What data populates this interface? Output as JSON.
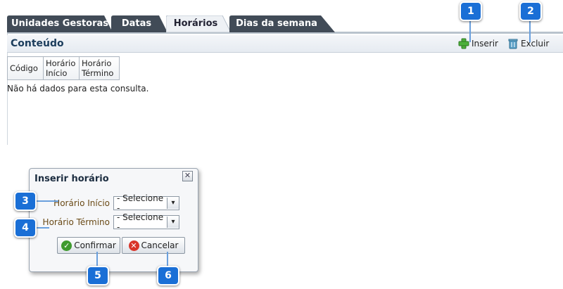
{
  "tabs": [
    {
      "label": "Unidades Gestoras",
      "active": false
    },
    {
      "label": "Datas",
      "active": false
    },
    {
      "label": "Horários",
      "active": true
    },
    {
      "label": "Dias da semana",
      "active": false
    }
  ],
  "panel": {
    "title": "Conteúdo",
    "insert_label": "Inserir",
    "delete_label": "Excluir",
    "columns": [
      "Código",
      "Horário Início",
      "Horário Término"
    ],
    "empty_message": "Não há dados para esta consulta."
  },
  "dialog": {
    "title": "Inserir horário",
    "start_label": "Horário Início",
    "start_value": "- Selecione -",
    "end_label": "Horário Término",
    "end_value": "- Selecione -",
    "confirm_label": "Confirmar",
    "cancel_label": "Cancelar"
  },
  "markers": [
    "1",
    "2",
    "3",
    "4",
    "5",
    "6"
  ],
  "colors": {
    "marker": "#1a6fd6",
    "tab_inactive": "#3f4a57",
    "tab_active": "#e9edf2",
    "title": "#1c3d5c"
  }
}
